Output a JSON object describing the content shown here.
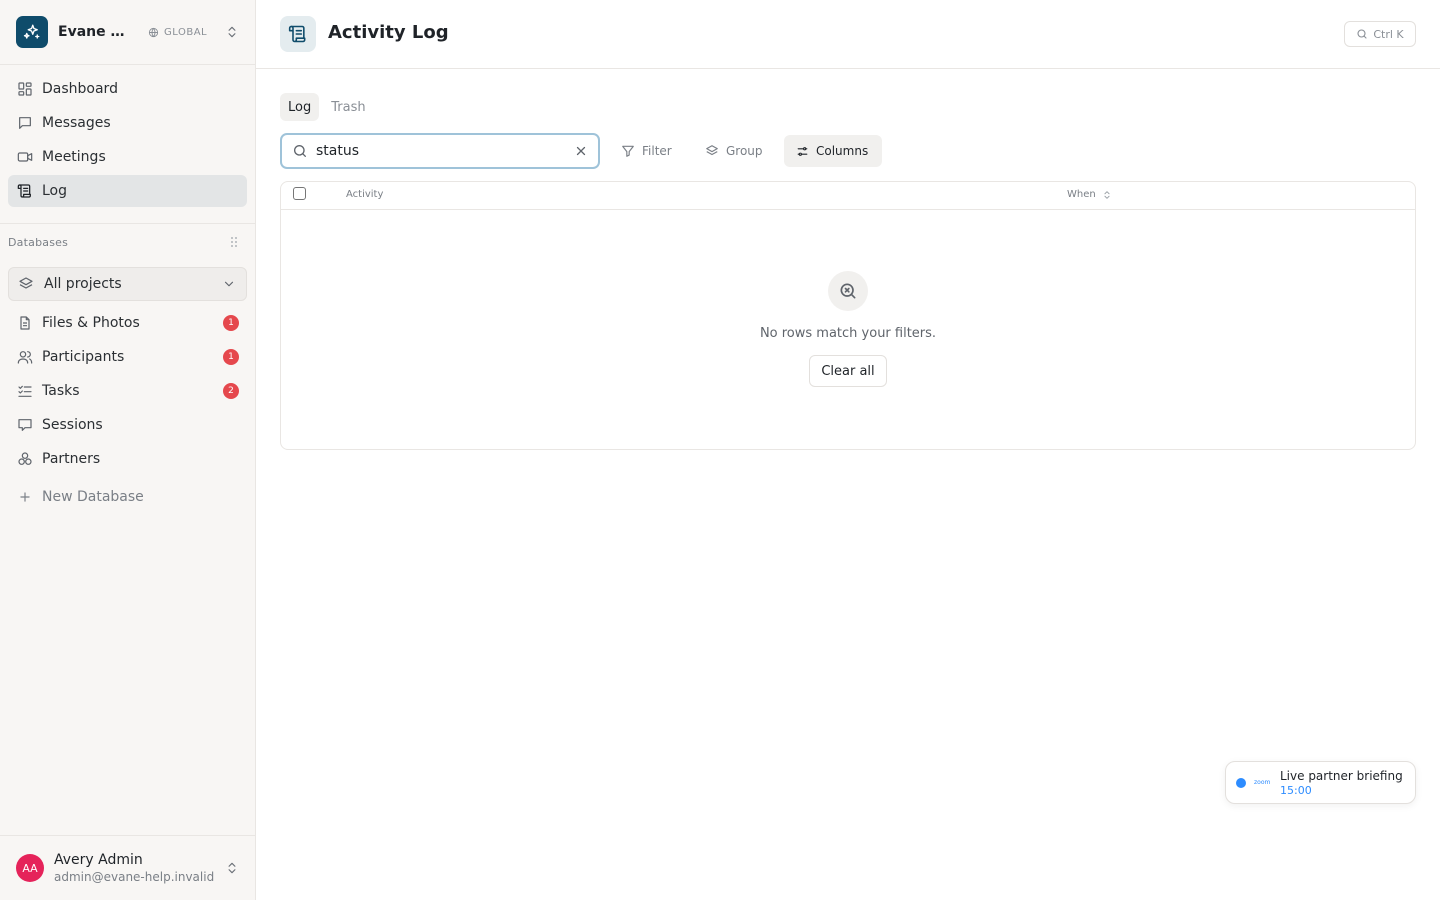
{
  "workspace": {
    "name": "Evane Help Center",
    "scope": "GLOBAL"
  },
  "nav": [
    {
      "label": "Dashboard",
      "icon": "dashboard-icon"
    },
    {
      "label": "Messages",
      "icon": "message-icon"
    },
    {
      "label": "Meetings",
      "icon": "video-icon"
    },
    {
      "label": "Log",
      "icon": "log-icon",
      "active": true
    }
  ],
  "databases": {
    "label": "Databases",
    "project_select": "All projects",
    "items": [
      {
        "label": "Files & Photos",
        "badge": "1"
      },
      {
        "label": "Participants",
        "badge": "1"
      },
      {
        "label": "Tasks",
        "badge": "2"
      },
      {
        "label": "Sessions",
        "badge": ""
      },
      {
        "label": "Partners",
        "badge": ""
      }
    ],
    "new_label": "New Database"
  },
  "user": {
    "initials": "AA",
    "name": "Avery Admin",
    "email": "admin@evane-help.invalid"
  },
  "header": {
    "title": "Activity Log",
    "shortcut": "Ctrl K"
  },
  "tabs": [
    {
      "label": "Log",
      "active": true
    },
    {
      "label": "Trash"
    }
  ],
  "toolbar": {
    "search_value": "status",
    "filter_label": "Filter",
    "group_label": "Group",
    "columns_label": "Columns"
  },
  "table": {
    "columns": [
      "Activity",
      "When"
    ],
    "empty_message": "No rows match your filters.",
    "clear_label": "Clear all"
  },
  "toast": {
    "app": "zoom",
    "title": "Live partner briefing",
    "time": "15:00"
  },
  "colors": {
    "brand": "#0f4c6b",
    "badge": "#e5484d",
    "avatar": "#e5235a",
    "focus": "#9fc3d9",
    "zoom": "#2d8cff"
  }
}
